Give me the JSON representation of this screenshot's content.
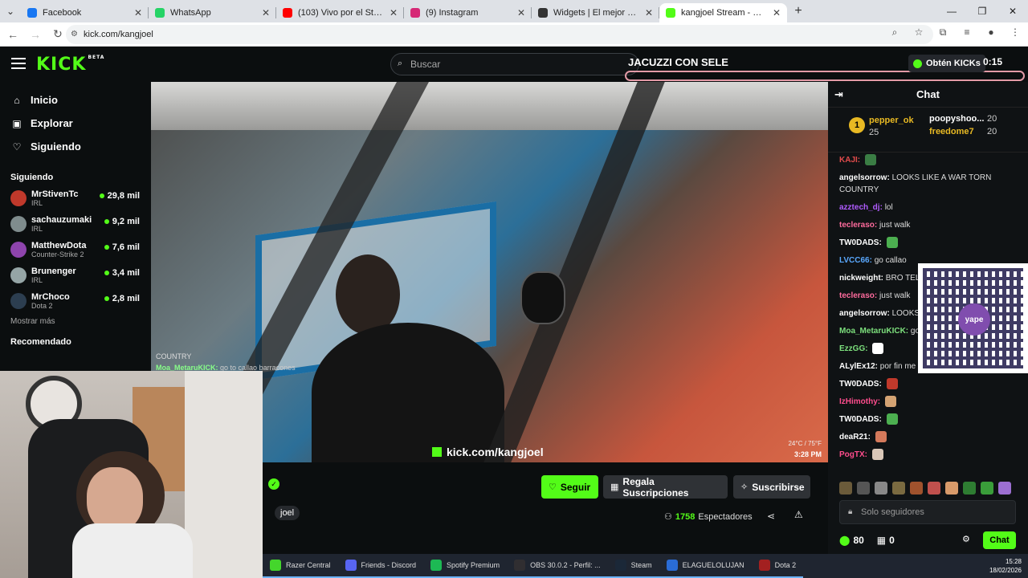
{
  "browser": {
    "tabs": [
      {
        "title": "Facebook",
        "color": "#1877f2"
      },
      {
        "title": "WhatsApp",
        "color": "#25d366"
      },
      {
        "title": "(103) Vivo por el Streaming - Yo",
        "color": "#ff0000"
      },
      {
        "title": "(9) Instagram",
        "color": "#d62976"
      },
      {
        "title": "Widgets | El mejor software par",
        "color": "#333333"
      },
      {
        "title": "kangjoel Stream - Watch Li",
        "color": "#53fc18"
      }
    ],
    "url": "kick.com/kangjoel"
  },
  "header": {
    "logo": "KICK",
    "logo_beta": "BETA",
    "search_placeholder": "Buscar",
    "overlay_title": "JACUZZI CON SELE",
    "kicks_label": "Obtén KICKs",
    "overlay_time": "0:15"
  },
  "sidebar": {
    "nav": [
      {
        "label": "Inicio",
        "icon": "home-icon"
      },
      {
        "label": "Explorar",
        "icon": "compass-icon"
      },
      {
        "label": "Siguiendo",
        "icon": "heart-icon"
      }
    ],
    "following_title": "Siguiendo",
    "channels": [
      {
        "name": "MrStivenTc",
        "category": "IRL",
        "viewers": "29,8 mil",
        "color": "#c0392b"
      },
      {
        "name": "sachauzumaki",
        "category": "IRL",
        "viewers": "9,2 mil",
        "color": "#7f8c8d"
      },
      {
        "name": "MatthewDota",
        "category": "Counter-Strike 2",
        "viewers": "7,6 mil",
        "color": "#8e44ad"
      },
      {
        "name": "Brunenger",
        "category": "IRL",
        "viewers": "3,4 mil",
        "color": "#95a5a6"
      },
      {
        "name": "MrChoco",
        "category": "Dota 2",
        "viewers": "2,8 mil",
        "color": "#2c3e50"
      }
    ],
    "show_more": "Mostrar más",
    "recommended": "Recomendado"
  },
  "video": {
    "overlay_country": "COUNTRY",
    "overlay_user": "Moa_MetaruKICK:",
    "overlay_msg": "go to callao barracones",
    "watermark": "kick.com/kangjoel",
    "weather": "24°C / 75°F",
    "clock": "3:28 PM"
  },
  "stream": {
    "tag": "joel",
    "follow": "Seguir",
    "gift": "Regala Suscripciones",
    "subscribe": "Suscribirse",
    "viewers": "1758",
    "viewers_label": "Espectadores"
  },
  "chat": {
    "title": "Chat",
    "pinned": {
      "rank": "1",
      "user1": "pepper_ok",
      "count1": "25",
      "user2": "poopyshoo...",
      "count2": "20",
      "user3": "freedome7",
      "count3": "20"
    },
    "messages": [
      {
        "user": "KAJI:",
        "text": "",
        "color": "#e34c4c",
        "emote": "#3a7d44"
      },
      {
        "user": "angelsorrow:",
        "text": "LOOKS LIKE A WAR TORN COUNTRY",
        "color": "#ffffff"
      },
      {
        "user": "azztech_dj:",
        "text": "lol",
        "color": "#b05cff"
      },
      {
        "user": "tecleraso:",
        "text": "just walk",
        "color": "#ff6b9d"
      },
      {
        "user": "TW0DADS:",
        "text": "",
        "color": "#ffffff",
        "emote": "#4caf50"
      },
      {
        "user": "LVCC66:",
        "text": "go callao",
        "color": "#5aa9ff"
      },
      {
        "user": "nickweight:",
        "text": "BRO TEL",
        "color": "#ffffff"
      },
      {
        "user": "tecleraso:",
        "text": "just walk",
        "color": "#ff6b9d"
      },
      {
        "user": "angelsorrow:",
        "text": "LOOKS COUNTRY",
        "color": "#ffffff"
      },
      {
        "user": "Moa_MetaruKICK:",
        "text": "go",
        "color": "#7de07d"
      },
      {
        "user": "EzzGG:",
        "text": "",
        "color": "#7de07d",
        "emote": "#ffffff"
      },
      {
        "user": "ALylEx12:",
        "text": "por fin me das show chino loco",
        "color": "#ffffff"
      },
      {
        "user": "TW0DADS:",
        "text": "",
        "color": "#ffffff",
        "emote": "#c0392b"
      },
      {
        "user": "IzHimothy:",
        "text": "",
        "color": "#ff4d8d",
        "emote": "#d4a373"
      },
      {
        "user": "TW0DADS:",
        "text": "",
        "color": "#ffffff",
        "emote": "#4caf50"
      },
      {
        "user": "deaR21:",
        "text": "",
        "color": "#ffffff",
        "emote": "#d4795b"
      },
      {
        "user": "PogTX:",
        "text": "",
        "color": "#ff4d8d",
        "emote": "#d9c7b8"
      }
    ],
    "qr_logo": "yape",
    "input_placeholder": "Solo seguidores",
    "points": "80",
    "gifts": "0",
    "send": "Chat"
  },
  "taskbar": {
    "items": [
      {
        "label": "Razer Central",
        "color": "#44d62c"
      },
      {
        "label": "Friends - Discord",
        "color": "#5865f2"
      },
      {
        "label": "Spotify Premium",
        "color": "#1db954"
      },
      {
        "label": "OBS 30.0.2 - Perfil: ...",
        "color": "#302e31"
      },
      {
        "label": "Steam",
        "color": "#1b2838"
      },
      {
        "label": "ELAGUELOLUJAN",
        "color": "#2a6cd6"
      },
      {
        "label": "Dota 2",
        "color": "#a32020"
      }
    ],
    "time": "15:28",
    "date": "18/02/2026"
  }
}
